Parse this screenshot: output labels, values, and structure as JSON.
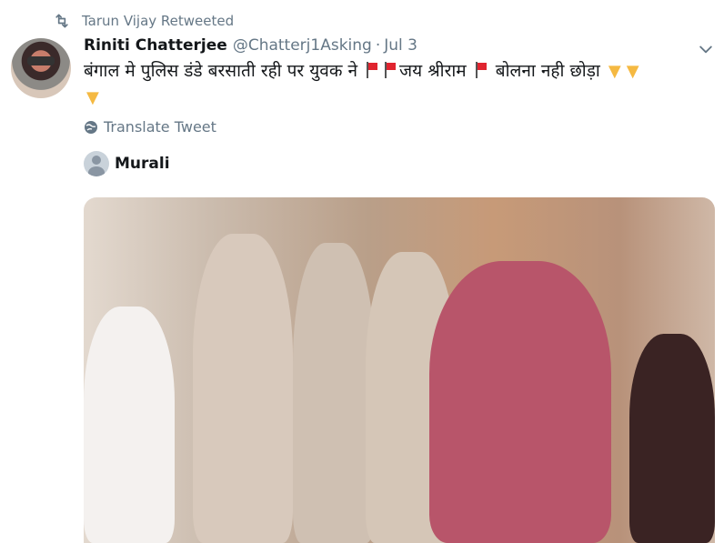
{
  "retweet": {
    "text": "Tarun Vijay Retweeted"
  },
  "tweet": {
    "name": "Riniti Chatterjee",
    "handle": "@Chatterj1Asking",
    "separator": "·",
    "date": "Jul 3",
    "text_part1": "बंगाल मे पुलिस डंडे बरसाती रही पर युवक ने",
    "text_part2": "जय श्रीराम",
    "text_part3": "बोलना नही छोड़ा",
    "translate_label": "Translate Tweet"
  },
  "quoted": {
    "name": "Murali"
  },
  "icons": {
    "retweet": "retweet-icon",
    "more": "chevron-down-icon",
    "globe": "globe-icon",
    "flag": "red-flag-emoji",
    "hand": "backhand-index-pointing-down-emoji"
  },
  "colors": {
    "secondary_text": "#657786",
    "primary_text": "#14171a",
    "flag_red": "#e0242f"
  }
}
